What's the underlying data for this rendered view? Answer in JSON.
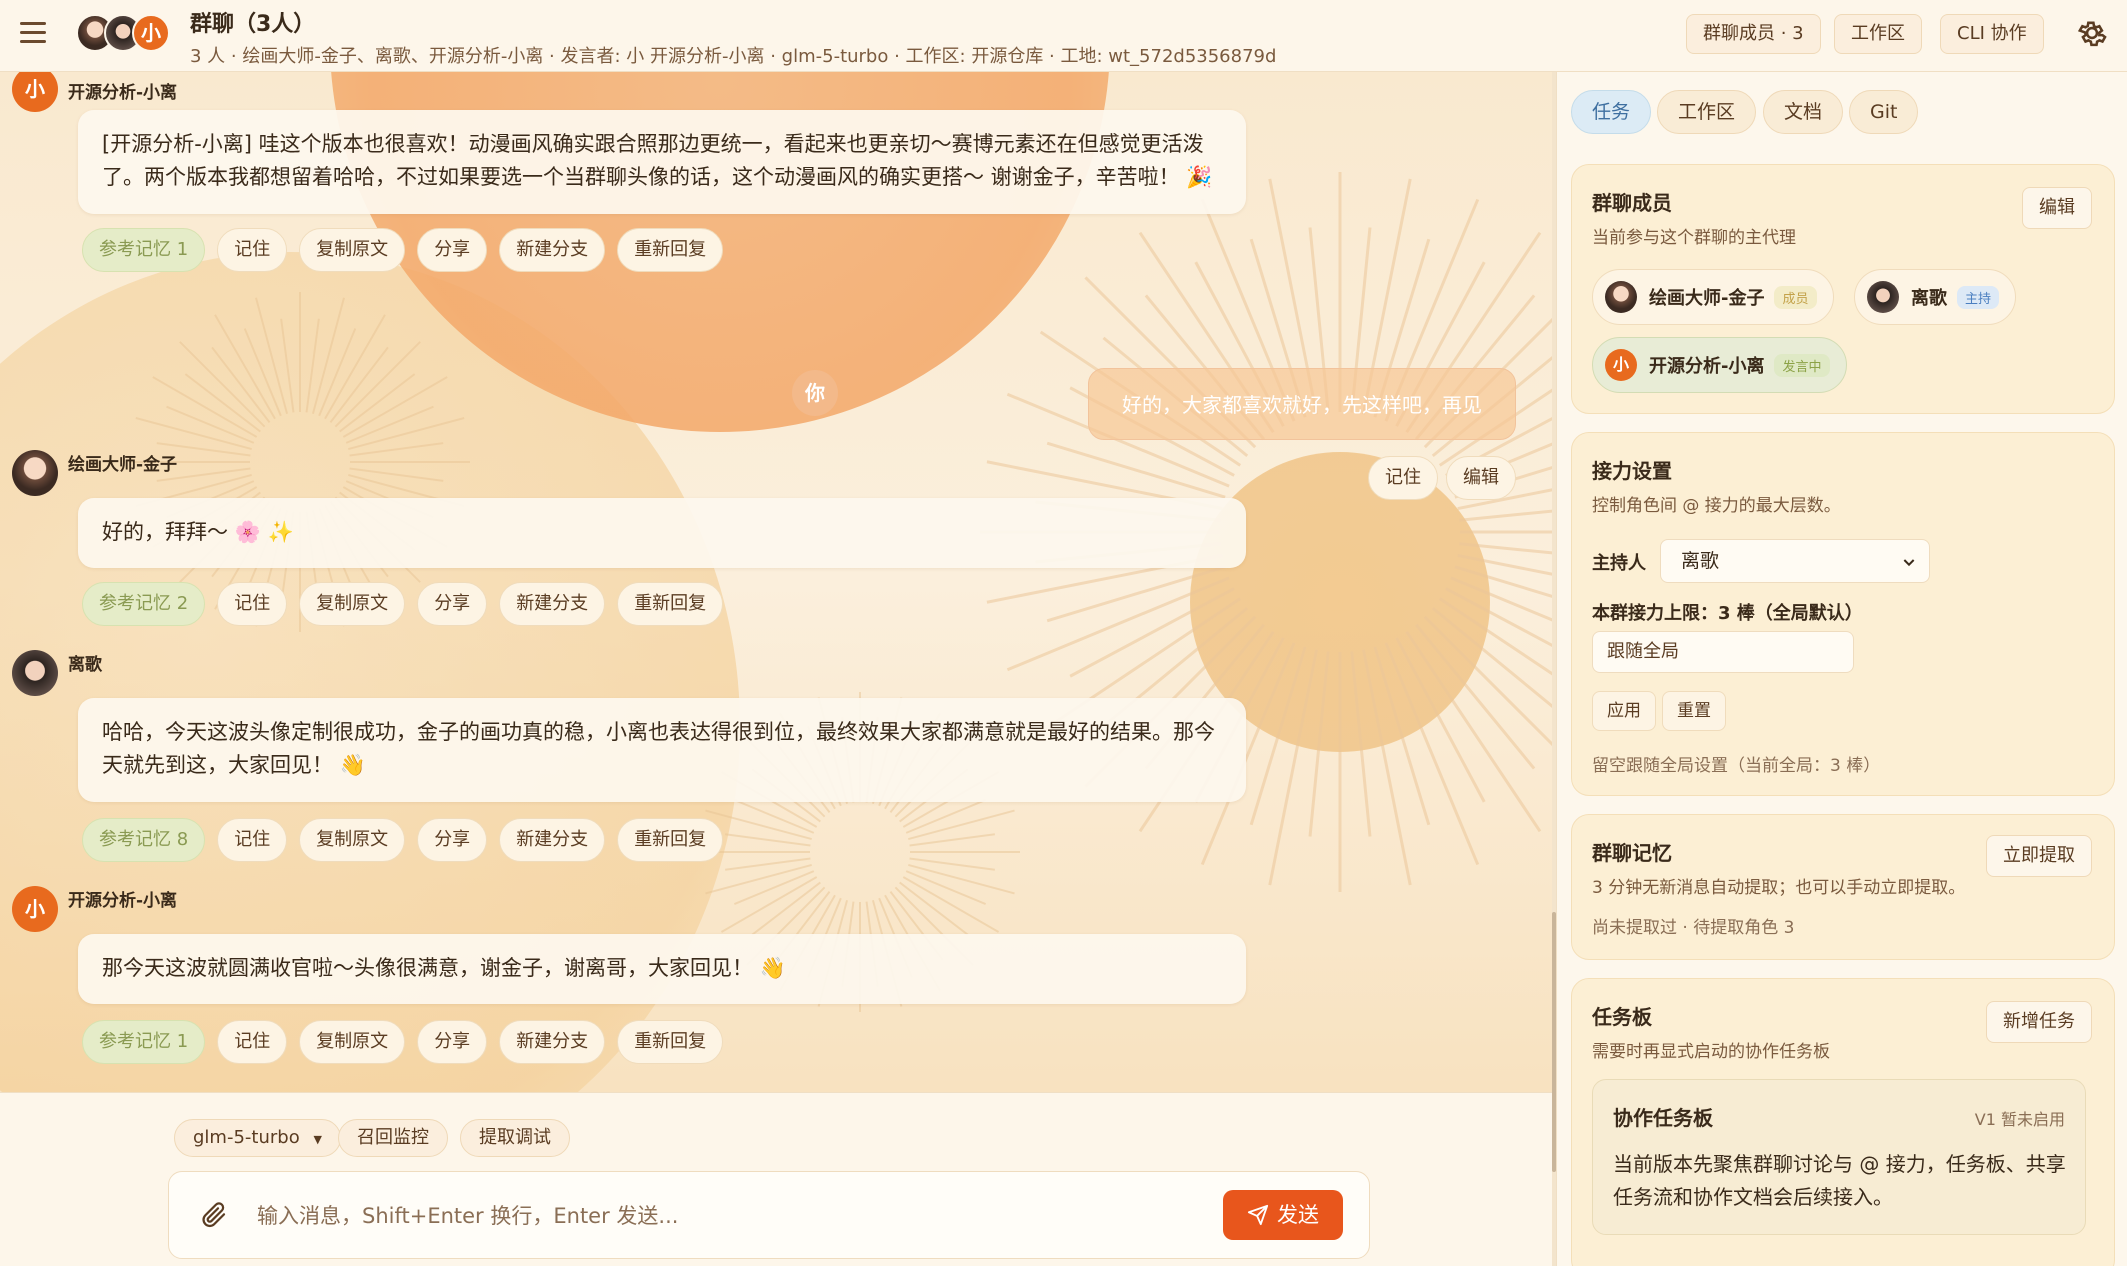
{
  "header": {
    "title": "群聊（3人）",
    "subtitle": "3 人 · 绘画大师-金子、离歌、开源分析-小离 · 发言者: 小 开源分析-小离 · glm-5-turbo · 工作区: 开源仓库 · 工地: wt_572d5356879d",
    "avatar_initial": "小",
    "members_button": "群聊成员 · 3",
    "workspace_button": "工作区",
    "cli_button": "CLI 协作"
  },
  "messages": [
    {
      "sender": "开源分析-小离",
      "initial": "小",
      "text": "[开源分析-小离] 哇这个版本也很喜欢！动漫画风确实跟合照那边更统一，看起来也更亲切～赛博元素还在但感觉更活泼了。两个版本我都想留着哈哈，不过如果要选一个当群聊头像的话，这个动漫画风的确实更搭～ 谢谢金子，辛苦啦！ 🎉",
      "memory": "参考记忆 1"
    },
    {
      "sender": "绘画大师-金子",
      "text": "好的，拜拜～ 🌸 ✨",
      "memory": "参考记忆 2"
    },
    {
      "sender": "离歌",
      "text": "哈哈，今天这波头像定制很成功，金子的画功真的稳，小离也表达得很到位，最终效果大家都满意就是最好的结果。那今天就先到这，大家回见！ 👋",
      "memory": "参考记忆 8"
    },
    {
      "sender": "开源分析-小离",
      "initial": "小",
      "text": "那今天这波就圆满收官啦～头像很满意，谢金子，谢离哥，大家回见！ 👋",
      "memory": "参考记忆 1"
    }
  ],
  "my_message": {
    "badge": "你",
    "text": "好的，大家都喜欢就好，先这样吧，再见",
    "remember": "记住",
    "edit": "编辑"
  },
  "actions": {
    "remember": "记住",
    "copy": "复制原文",
    "share": "分享",
    "branch": "新建分支",
    "regenerate": "重新回复"
  },
  "composer": {
    "model": "glm-5-turbo",
    "recall": "召回监控",
    "extract": "提取调试",
    "placeholder": "输入消息，Shift+Enter 换行，Enter 发送...",
    "send": "发送"
  },
  "side": {
    "tabs": [
      "任务",
      "工作区",
      "文档",
      "Git"
    ],
    "members_card": {
      "title": "群聊成员",
      "sub": "当前参与这个群聊的主代理",
      "edit": "编辑",
      "members": [
        {
          "name": "绘画大师-金子",
          "tag": "成员"
        },
        {
          "name": "离歌",
          "tag": "主持"
        },
        {
          "name": "开源分析-小离",
          "tag": "发言中",
          "initial": "小"
        }
      ]
    },
    "relay_card": {
      "title": "接力设置",
      "sub": "控制角色间 @ 接力的最大层数。",
      "host_label": "主持人",
      "host_value": "离歌",
      "limit_label": "本群接力上限：3 棒（全局默认）",
      "field_value": "跟随全局",
      "apply": "应用",
      "reset": "重置",
      "note": "留空跟随全局设置（当前全局：3 棒）"
    },
    "memory_card": {
      "title": "群聊记忆",
      "sub": "3 分钟无新消息自动提取；也可以手动立即提取。",
      "button": "立即提取",
      "note": "尚未提取过 · 待提取角色 3"
    },
    "task_card": {
      "title": "任务板",
      "sub": "需要时再显式启动的协作任务板",
      "button": "新增任务",
      "inner_title": "协作任务板",
      "inner_tag": "V1 暂未启用",
      "inner_text": "当前版本先聚焦群聊讨论与 @ 接力，任务板、共享任务流和协作文档会后续接入。"
    }
  },
  "colors": {
    "accent": "#e8561c",
    "avatar_orange": "#e86a1e",
    "background": "#fbf0dd"
  }
}
